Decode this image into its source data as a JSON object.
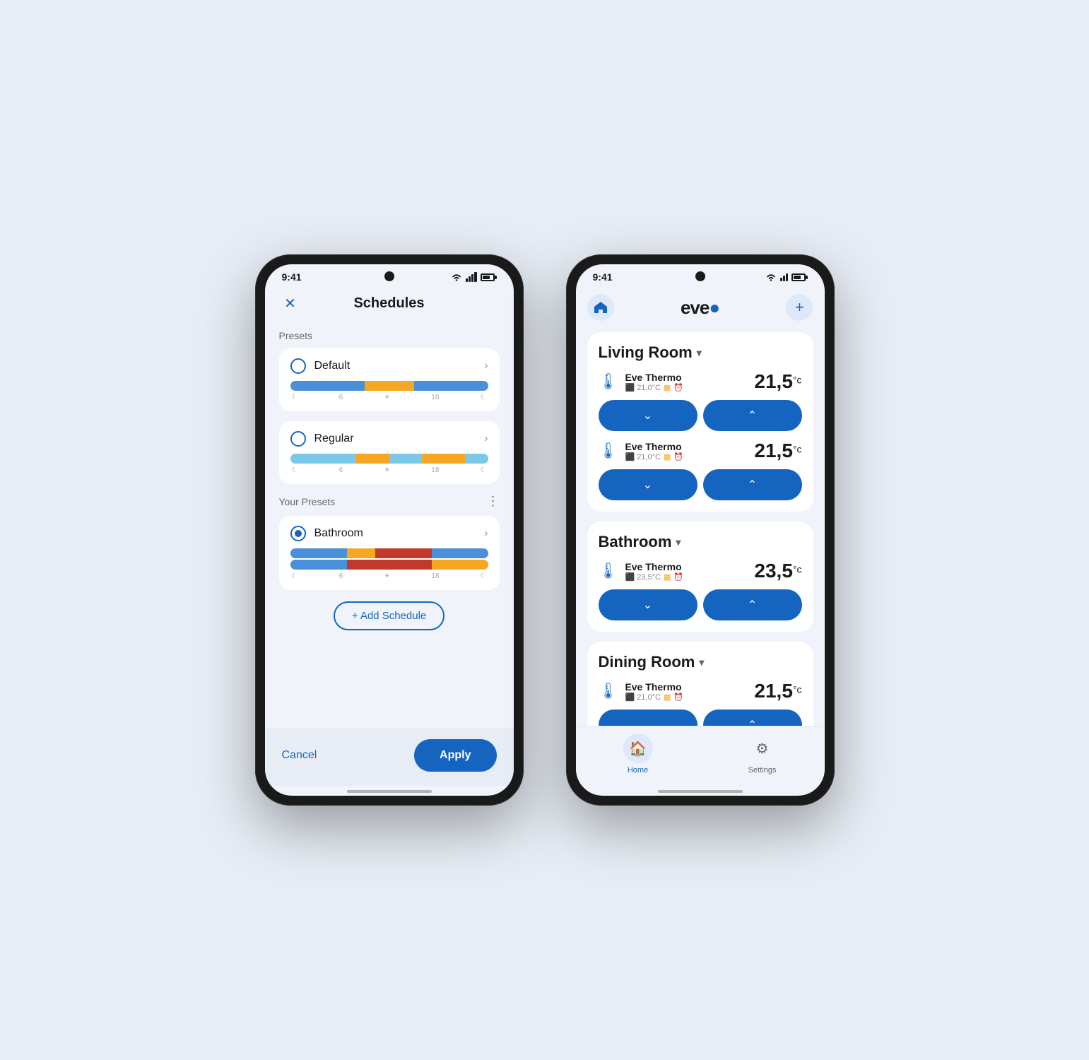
{
  "colors": {
    "primary": "#1565c0",
    "bg": "#f0f4fa",
    "white": "#ffffff",
    "text": "#1a1a1a",
    "muted": "#888888"
  },
  "phone1": {
    "status": {
      "time": "9:41"
    },
    "header": {
      "title": "Schedules",
      "close_label": "×"
    },
    "presets_label": "Presets",
    "your_presets_label": "Your Presets",
    "presets": [
      {
        "name": "Default",
        "selected": false,
        "bar_segments": [
          {
            "color": "#4a90d9",
            "flex": 3
          },
          {
            "color": "#f5a623",
            "flex": 2
          },
          {
            "color": "#4a90d9",
            "flex": 3
          }
        ],
        "ticks": [
          "☾",
          "6",
          "☀",
          "18",
          "☾"
        ]
      },
      {
        "name": "Regular",
        "selected": false,
        "bar_segments": [
          {
            "color": "#7bc8e8",
            "flex": 3
          },
          {
            "color": "#f5a623",
            "flex": 1.5
          },
          {
            "color": "#7bc8e8",
            "flex": 1.5
          },
          {
            "color": "#f5a623",
            "flex": 2
          },
          {
            "color": "#7bc8e8",
            "flex": 1
          }
        ],
        "ticks": [
          "☾",
          "6",
          "☀",
          "18",
          "☾"
        ]
      }
    ],
    "your_presets": [
      {
        "name": "Bathroom",
        "selected": true,
        "bar_segments_top": [
          {
            "color": "#4a90d9",
            "flex": 2
          },
          {
            "color": "#f5a623",
            "flex": 1
          },
          {
            "color": "#c0392b",
            "flex": 2
          },
          {
            "color": "#4a90d9",
            "flex": 2
          }
        ],
        "bar_segments_bottom": [
          {
            "color": "#4a90d9",
            "flex": 2
          },
          {
            "color": "#c0392b",
            "flex": 3
          },
          {
            "color": "#f5a623",
            "flex": 2
          }
        ],
        "ticks": [
          "☾",
          "6",
          "☀",
          "18",
          "☾"
        ]
      }
    ],
    "add_schedule_label": "+ Add Schedule",
    "cancel_label": "Cancel",
    "apply_label": "Apply"
  },
  "phone2": {
    "status": {
      "time": "9:41"
    },
    "header": {
      "logo_text": "eve",
      "logo_dot": "."
    },
    "rooms": [
      {
        "name": "Living Room",
        "devices": [
          {
            "name": "Eve Thermo",
            "sub_temp": "21,0°C",
            "temperature": "21,5",
            "unit": "°c"
          },
          {
            "name": "Eve Thermo",
            "sub_temp": "21,0°C",
            "temperature": "21,5",
            "unit": "°c"
          }
        ]
      },
      {
        "name": "Bathroom",
        "devices": [
          {
            "name": "Eve Thermo",
            "sub_temp": "23,5°C",
            "temperature": "23,5",
            "unit": "°c"
          }
        ]
      },
      {
        "name": "Dining Room",
        "devices": [
          {
            "name": "Eve Thermo",
            "sub_temp": "21,0°C",
            "temperature": "21,5",
            "unit": "°c"
          }
        ]
      }
    ],
    "nav": [
      {
        "label": "Home",
        "active": true,
        "icon": "🏠"
      },
      {
        "label": "Settings",
        "active": false,
        "icon": "⚙"
      }
    ]
  }
}
